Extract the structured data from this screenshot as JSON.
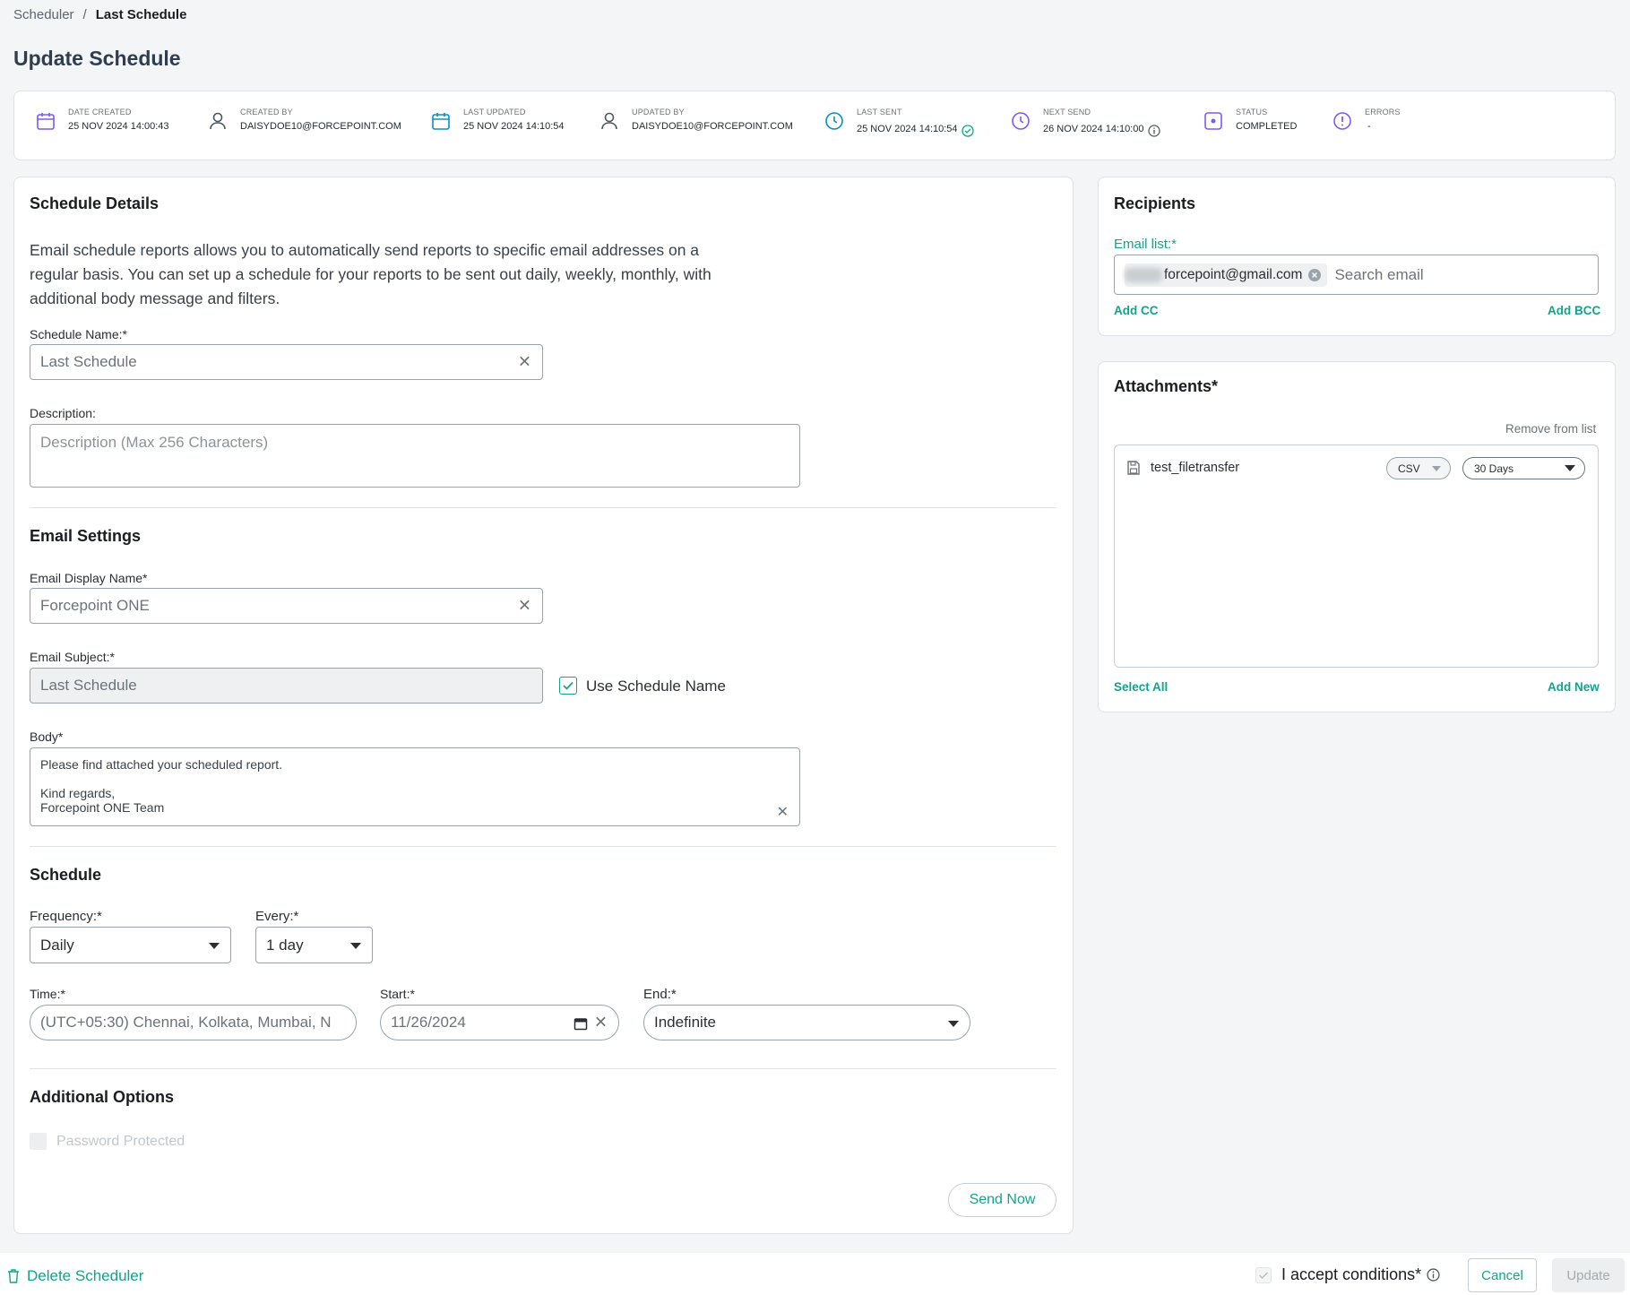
{
  "breadcrumb": {
    "parent": "Scheduler",
    "current": "Last Schedule",
    "separator": "/"
  },
  "page_title": "Update Schedule",
  "meta": [
    {
      "caption": "DATE CREATED",
      "value": "25 NOV 2024 14:00:43",
      "icon": "calendar-icon"
    },
    {
      "caption": "CREATED BY",
      "value": "DAISYDOE10@FORCEPOINT.COM",
      "icon": "user-icon"
    },
    {
      "caption": "LAST UPDATED",
      "value": "25 NOV 2024 14:10:54",
      "icon": "calendar-icon"
    },
    {
      "caption": "UPDATED BY",
      "value": "DAISYDOE10@FORCEPOINT.COM",
      "icon": "user-icon"
    },
    {
      "caption": "LAST SENT",
      "value": "25 NOV 2024 14:10:54",
      "icon": "clock-icon"
    },
    {
      "caption": "NEXT SEND",
      "value": "26 NOV 2024 14:10:00",
      "icon": "clock-icon"
    },
    {
      "caption": "STATUS",
      "value": "COMPLETED",
      "icon": "status-icon"
    },
    {
      "caption": "ERRORS",
      "value": "-",
      "icon": "alert-icon"
    }
  ],
  "details": {
    "title": "Schedule Details",
    "intro_1": "Email schedule reports allows you to automatically send reports to specific email addresses on a",
    "intro_2": "regular basis. You can set up a schedule for your reports to be sent out daily, weekly, monthly, with",
    "intro_3": "additional body message and filters.",
    "name_label": "Schedule Name:*",
    "name_value": "Last Schedule",
    "desc_label": "Description:",
    "desc_placeholder": "Description (Max 256 Characters)"
  },
  "email": {
    "title": "Email Settings",
    "display_label": "Email Display Name*",
    "display_value": "Forcepoint ONE",
    "subject_label": "Email Subject:*",
    "subject_value": "Last Schedule",
    "use_name_label": "Use Schedule Name",
    "body_label": "Body*",
    "body_line1": "Please find attached your scheduled report.",
    "body_line2": "Kind regards,",
    "body_line3": "Forcepoint ONE Team"
  },
  "schedule": {
    "title": "Schedule",
    "frequency_label": "Frequency:*",
    "frequency_value": "Daily",
    "every_label": "Every:*",
    "every_value": "1 day",
    "time_label": "Time:*",
    "time_value": "(UTC+05:30) Chennai, Kolkata, Mumbai, N",
    "start_label": "Start:*",
    "start_value": "11/26/2024",
    "end_label": "End:*",
    "end_value": "Indefinite"
  },
  "additional": {
    "title": "Additional Options",
    "password_label": "Password Protected",
    "send_now": "Send Now"
  },
  "recipients": {
    "title": "Recipients",
    "list_label": "Email list:*",
    "chip": "forcepoint@gmail.com",
    "search_placeholder": "Search email",
    "add_cc": "Add CC",
    "add_bcc": "Add BCC"
  },
  "attachments": {
    "title": "Attachments*",
    "remove": "Remove from list",
    "item_name": "test_filetransfer",
    "format": "CSV",
    "range": "30 Days",
    "select_all": "Select All",
    "add_new": "Add New"
  },
  "footer": {
    "delete": "Delete Scheduler",
    "accept": "I accept conditions*",
    "cancel": "Cancel",
    "update": "Update"
  },
  "colors": {
    "accent": "#14a38b",
    "icon": "#7b5cf0"
  }
}
